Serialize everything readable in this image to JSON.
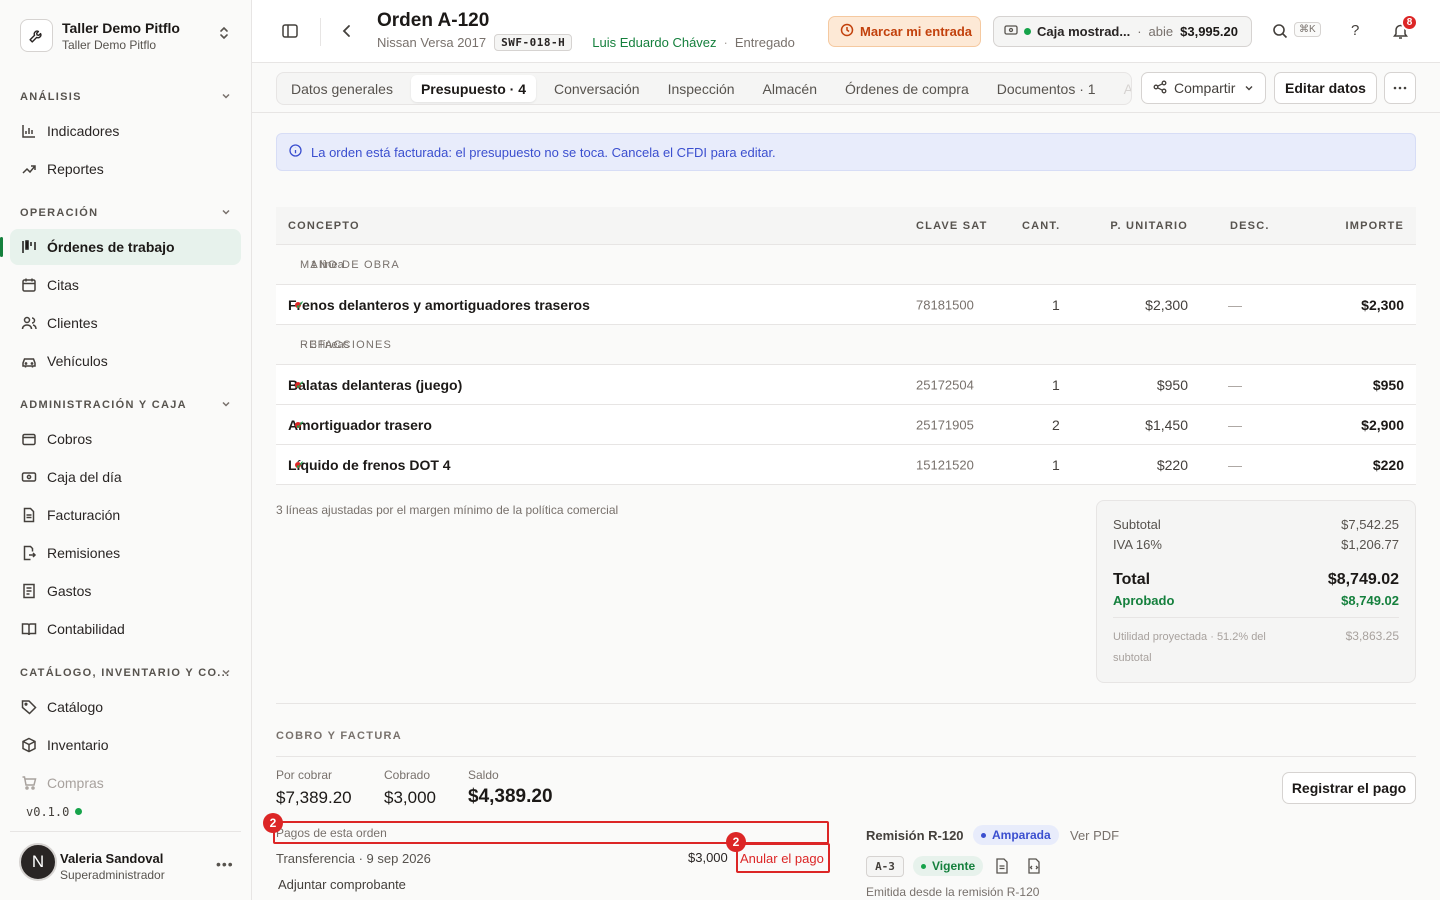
{
  "workspace": {
    "name": "Taller Demo Pitflo",
    "subtitle": "Taller Demo Pitflo"
  },
  "sidebar": {
    "sections": [
      {
        "title": "ANÁLISIS",
        "items": [
          {
            "label": "Indicadores",
            "icon": "bar-chart-icon"
          },
          {
            "label": "Reportes",
            "icon": "trend-icon"
          }
        ]
      },
      {
        "title": "OPERACIÓN",
        "items": [
          {
            "label": "Órdenes de trabajo",
            "icon": "kanban-icon",
            "active": true
          },
          {
            "label": "Citas",
            "icon": "calendar-icon"
          },
          {
            "label": "Clientes",
            "icon": "users-icon"
          },
          {
            "label": "Vehículos",
            "icon": "car-icon"
          }
        ]
      },
      {
        "title": "ADMINISTRACIÓN Y CAJA",
        "items": [
          {
            "label": "Cobros",
            "icon": "wallet-icon"
          },
          {
            "label": "Caja del día",
            "icon": "cash-register-icon"
          },
          {
            "label": "Facturación",
            "icon": "invoice-icon"
          },
          {
            "label": "Remisiones",
            "icon": "file-export-icon"
          },
          {
            "label": "Gastos",
            "icon": "receipt-icon"
          },
          {
            "label": "Contabilidad",
            "icon": "book-icon"
          }
        ]
      },
      {
        "title": "CATÁLOGO, INVENTARIO Y CO...",
        "items": [
          {
            "label": "Catálogo",
            "icon": "tag-icon"
          },
          {
            "label": "Inventario",
            "icon": "box-icon"
          },
          {
            "label": "Compras",
            "icon": "cart-icon"
          }
        ]
      }
    ],
    "version": "v0.1.0",
    "user": {
      "initial": "N",
      "name": "Valeria Sandoval",
      "role": "Superadministrador"
    }
  },
  "header": {
    "title": "Orden A-120",
    "vehicle": "Nissan Versa 2017",
    "plate": "SWF-018-H",
    "technician": "Luis Eduardo Chávez",
    "separator": "·",
    "status": "Entregado",
    "clock_in_label": "Marcar mi entrada",
    "cash_name": "Caja mostrad...",
    "cash_separator": "·",
    "cash_state": "abie",
    "cash_amount": "$3,995.20",
    "search_shortcut": "⌘K",
    "help_label": "?",
    "notifications_count": "8"
  },
  "tabs": [
    {
      "label": "Datos generales"
    },
    {
      "label": "Presupuesto · 4",
      "active": true
    },
    {
      "label": "Conversación"
    },
    {
      "label": "Inspección"
    },
    {
      "label": "Almacén"
    },
    {
      "label": "Órdenes de compra"
    },
    {
      "label": "Documentos · 1"
    },
    {
      "label": "Ad"
    }
  ],
  "actions": {
    "share_label": "Compartir",
    "edit_label": "Editar datos"
  },
  "alert": {
    "text": "La orden está facturada: el presupuesto no se toca. Cancela el CFDI para editar."
  },
  "table": {
    "columns": {
      "concept": "CONCEPTO",
      "sat": "CLAVE SAT",
      "qty": "CANT.",
      "unit": "P. UNITARIO",
      "disc": "DESC.",
      "amount": "IMPORTE"
    },
    "groups": [
      {
        "title": "MANO DE OBRA",
        "count": "· 1 línea",
        "rows": [
          {
            "name": "Frenos delanteros y amortiguadores traseros",
            "sat": "78181500",
            "qty": "1",
            "unit": "$2,300",
            "disc": "—",
            "amount": "$2,300"
          }
        ]
      },
      {
        "title": "REFACCIONES",
        "count": "· 3 líneas",
        "rows": [
          {
            "name": "Balatas delanteras (juego)",
            "sat": "25172504",
            "qty": "1",
            "unit": "$950",
            "disc": "—",
            "amount": "$950"
          },
          {
            "name": "Amortiguador trasero",
            "sat": "25171905",
            "qty": "2",
            "unit": "$1,450",
            "disc": "—",
            "amount": "$2,900"
          },
          {
            "name": "Líquido de frenos DOT 4",
            "sat": "15121520",
            "qty": "1",
            "unit": "$220",
            "disc": "—",
            "amount": "$220"
          }
        ]
      }
    ],
    "check_glyph": "✓",
    "note": "3 líneas ajustadas por el margen mínimo de la política comercial"
  },
  "totals": {
    "subtotal_label": "Subtotal",
    "subtotal": "$7,542.25",
    "iva_label": "IVA 16%",
    "iva": "$1,206.77",
    "total_label": "Total",
    "total": "$8,749.02",
    "approved_label": "Aprobado",
    "approved": "$8,749.02",
    "profit_label": "Utilidad proyectada · 51.2% del subtotal",
    "profit": "$3,863.25"
  },
  "billing": {
    "section_title": "COBRO Y FACTURA",
    "to_collect_label": "Por cobrar",
    "to_collect": "$7,389.20",
    "collected_label": "Cobrado",
    "collected": "$3,000",
    "balance_label": "Saldo",
    "balance": "$4,389.20",
    "register_payment_label": "Registrar el pago",
    "payments_title": "Pagos de esta orden",
    "payment": {
      "desc": "Transferencia · 9 sep 2026",
      "amount": "$3,000",
      "void_label": "Anular el pago"
    },
    "attach_label": "Adjuntar comprobante",
    "annotation_badge": "2",
    "remission": {
      "title": "Remisión R-120",
      "status": "Amparada",
      "pdf_label": "Ver PDF",
      "series": "A-3",
      "invoice_status": "Vigente",
      "note": "Emitida desde la remisión R-120"
    }
  }
}
